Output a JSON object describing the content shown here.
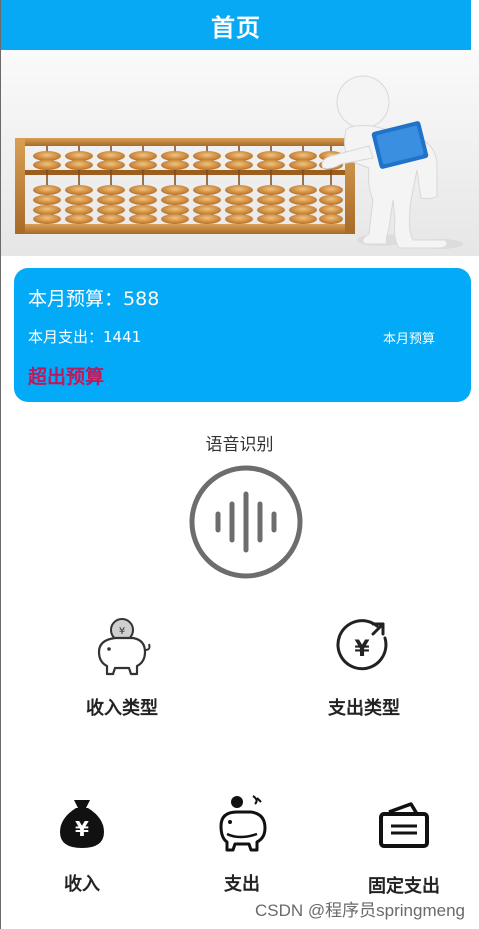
{
  "header": {
    "title": "首页"
  },
  "banner": {
    "image_name": "abacus-illustration"
  },
  "budget": {
    "budget_label": "本月预算：",
    "budget_value": "588",
    "expense_label": "本月支出：",
    "expense_value": "1441",
    "budget_link": "本月预算",
    "status": "超出预算",
    "colors": {
      "card": "#03aaf7",
      "status": "#c2185b"
    }
  },
  "voice": {
    "label": "语音识别",
    "icon": "voice-wave-icon"
  },
  "categories": [
    {
      "label": "收入类型",
      "icon": "piggy-bank-coin-icon"
    },
    {
      "label": "支出类型",
      "icon": "yuan-exchange-icon"
    }
  ],
  "actions": [
    {
      "label": "收入",
      "icon": "money-bag-icon"
    },
    {
      "label": "支出",
      "icon": "piggy-expense-icon"
    },
    {
      "label": "固定支出",
      "icon": "wallet-icon"
    }
  ],
  "watermark": "CSDN @程序员springmeng",
  "theme": {
    "primary": "#07a9f5"
  }
}
